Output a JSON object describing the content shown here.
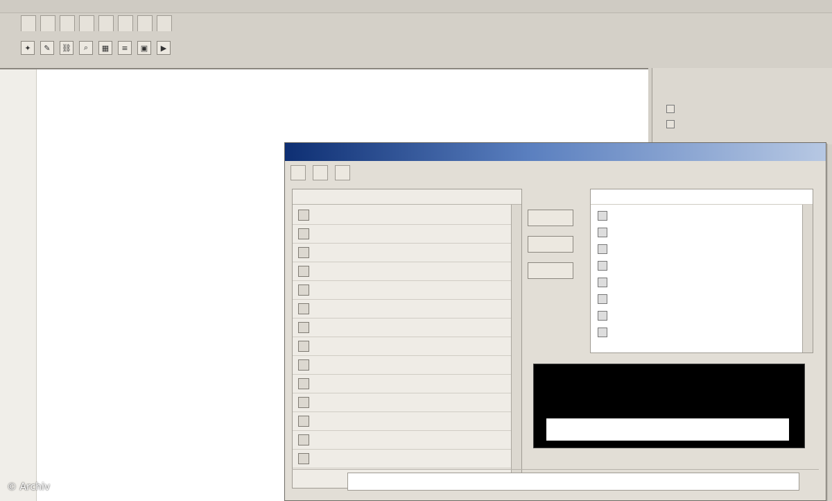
{
  "watermark": {
    "text": "© Archiv"
  },
  "ui": {
    "accent_titlebar_dark": "#0e2f73",
    "accent_selection": "#2a4f9a",
    "preview_bg": "#000000",
    "preview_text": "#b23a3a"
  },
  "tabbar": {
    "tabs": []
  },
  "toolbar": {
    "icons": [
      "wand-icon",
      "pencil-icon",
      "link-icon",
      "magnify-icon",
      "grid-icon",
      "list-icon",
      "media-icon",
      "play-icon"
    ]
  },
  "editor": {
    "lines": []
  },
  "right_panel": {
    "title": "",
    "items": []
  },
  "dialog": {
    "title": "",
    "tabs": [],
    "props": {
      "header_left": "",
      "header_right": "",
      "rows": []
    },
    "buttons": [],
    "color_list": {
      "header": "",
      "rows": []
    },
    "preview": {
      "title": "",
      "field": ""
    },
    "bottom": {
      "label": ""
    }
  }
}
